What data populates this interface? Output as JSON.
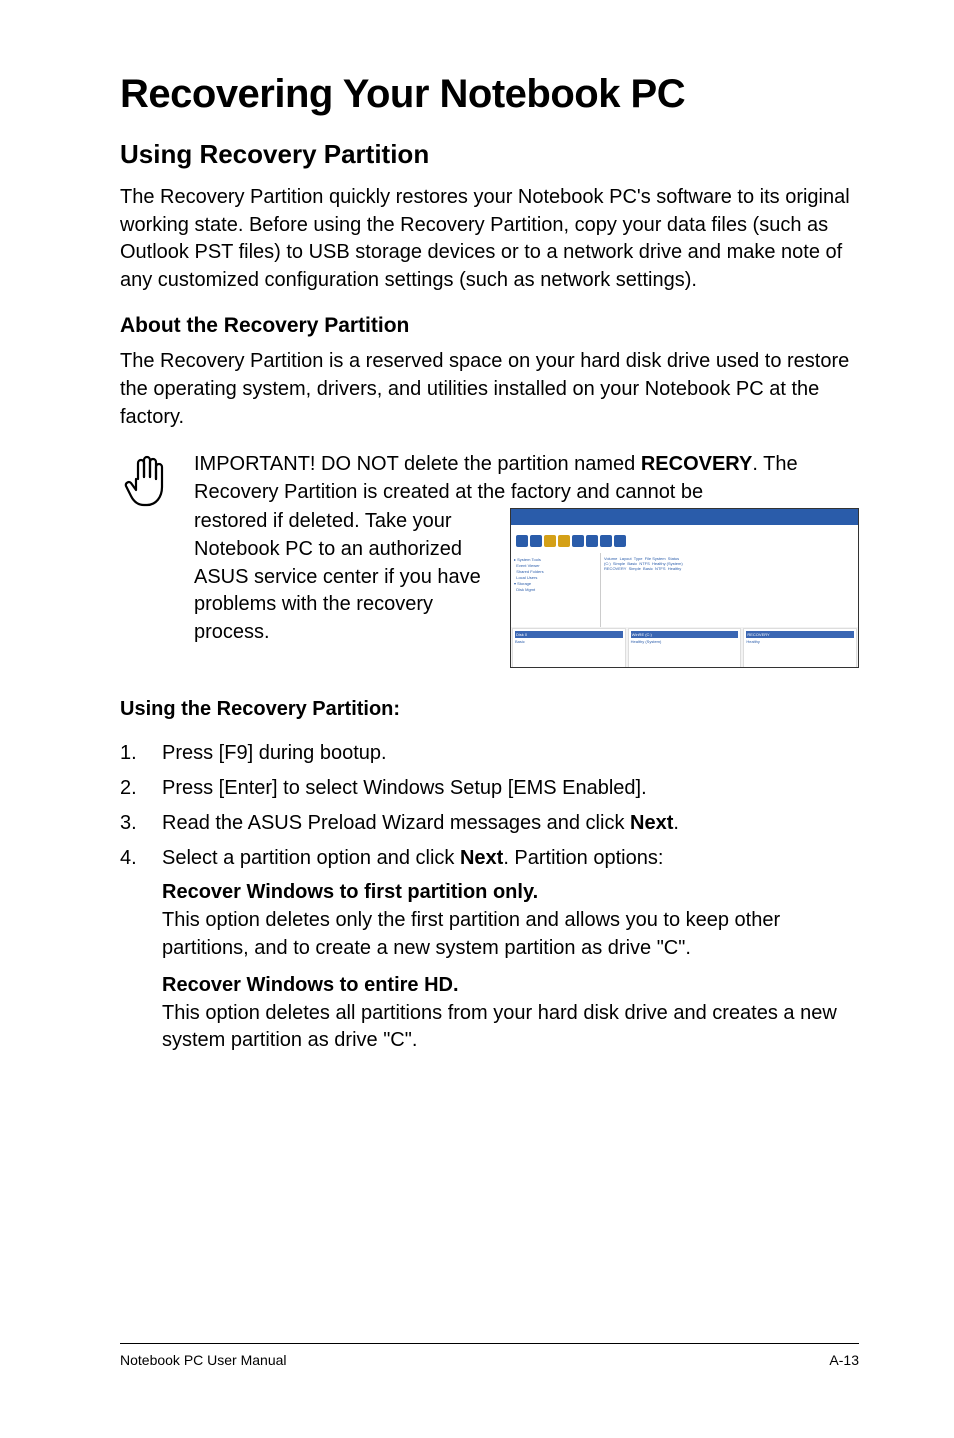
{
  "title": "Recovering Your Notebook PC",
  "section_heading": "Using Recovery Partition",
  "intro_paragraph": "The Recovery Partition quickly restores your Notebook PC's software to its original working state. Before using the Recovery Partition, copy your data files (such as Outlook PST files) to USB storage devices or to a network drive and make note of any customized configuration settings (such as network settings).",
  "about_heading": "About the Recovery Partition",
  "about_paragraph": "The Recovery Partition is a reserved space on your hard disk drive used to restore the operating system, drivers, and utilities installed on your Notebook PC at the factory.",
  "important_lead": "IMPORTANT! DO NOT delete the partition named ",
  "important_bold": "RECOVERY",
  "important_rest": ". The Recovery Partition is created at the factory and cannot be ",
  "important_after": "restored if deleted. Take your Notebook PC to an authorized ASUS service center if you have problems with the recovery process.",
  "using_heading": "Using the Recovery Partition:",
  "steps": [
    "Press [F9] during bootup.",
    "Press [Enter] to select Windows Setup [EMS Enabled].",
    {
      "pre": "Read the ASUS Preload Wizard messages and click ",
      "bold": "Next",
      "post": "."
    },
    {
      "pre": "Select a partition option and click ",
      "bold": "Next",
      "post": ". Partition options:"
    }
  ],
  "options": [
    {
      "title": "Recover Windows to first partition only.",
      "body": "This option deletes only the first partition and allows you to keep other partitions, and to create a new system partition as drive \"C\"."
    },
    {
      "title": "Recover Windows to entire HD.",
      "body": "This option deletes all partitions from your hard disk drive and creates a new system partition as drive \"C\"."
    }
  ],
  "footer_left": "Notebook PC User Manual",
  "footer_right": "A-13"
}
